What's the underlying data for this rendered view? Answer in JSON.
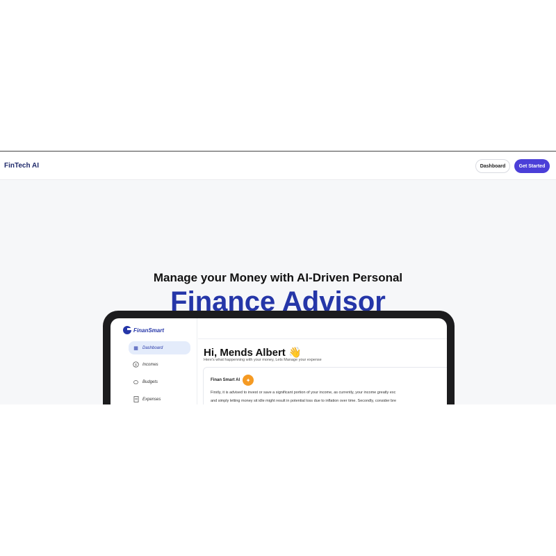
{
  "nav": {
    "brand": "FinTech AI",
    "dashboard_label": "Dashboard",
    "get_started_label": "Get Started"
  },
  "hero": {
    "subtitle": "Manage your Money with AI-Driven Personal",
    "title": "Finance Advisor"
  },
  "app": {
    "logo_text": "FinanSmart",
    "sidebar": {
      "items": [
        {
          "label": "Dashboard",
          "icon": "grid-icon"
        },
        {
          "label": "Incomes",
          "icon": "dollar-icon"
        },
        {
          "label": "Budgets",
          "icon": "piggy-bank-icon"
        },
        {
          "label": "Expenses",
          "icon": "receipt-icon"
        }
      ]
    },
    "greeting": "Hi, Mends Albert 👋",
    "greeting_sub": "Here's what happenning with your money, Lets Manage your expense",
    "advice_card": {
      "title": "Finan Smart AI",
      "line1": "Firstly, it is advised to invest or save a significant portion of your income, as currently, your income greatly exc",
      "line2": "and simply letting money sit idle might result in potential loss due to inflation over time. Secondly, consider bre"
    }
  },
  "colors": {
    "accent": "#4b3fd8",
    "title_blue": "#2536a8",
    "ai_badge": "#f59a23"
  }
}
